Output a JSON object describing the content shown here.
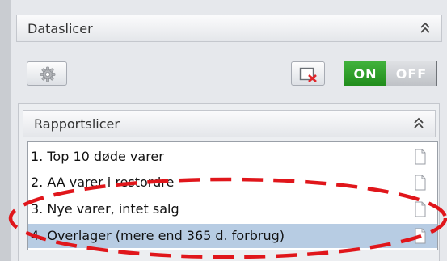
{
  "dataslicer": {
    "title": "Dataslicer",
    "collapse_icon": "chevron-double-up-icon",
    "settings_icon": "gear-icon",
    "clear_filter_icon": "clear-filter-icon",
    "toggle": {
      "on_label": "ON",
      "off_label": "OFF",
      "state": "on",
      "on_color": "#2ea02a",
      "off_color": "#c9ccd1"
    }
  },
  "rapportslicer": {
    "title": "Rapportslicer",
    "collapse_icon": "chevron-double-up-icon",
    "items": [
      {
        "label": "1. Top 10 døde varer",
        "icon": "document-icon",
        "selected": false
      },
      {
        "label": "2. AA varer i restordre",
        "icon": "document-icon",
        "selected": false
      },
      {
        "label": "3. Nye varer, intet salg",
        "icon": "document-icon",
        "selected": false
      },
      {
        "label": "4. Overlager (mere end 365 d. forbrug)",
        "icon": "document-icon",
        "selected": true
      }
    ],
    "selection_color": "#b7cce3"
  },
  "annotation": {
    "shape": "dashed-ellipse",
    "color": "#e0161b"
  }
}
